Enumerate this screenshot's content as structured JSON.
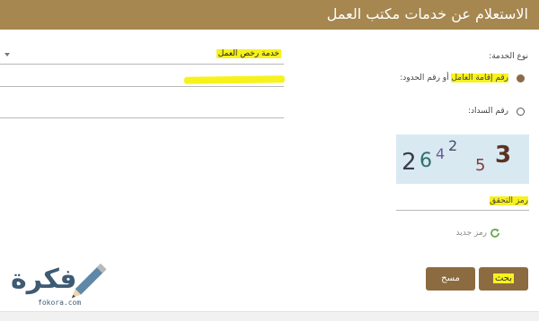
{
  "header": {
    "title": "الاستعلام عن خدمات مكتب العمل"
  },
  "form": {
    "service_type_label": "نوع الخدمة:",
    "service_select_value": "خدمة رخص العمل",
    "radio_iqama": {
      "highlight": "رقم إقامة العامل",
      "rest": " أو رقم الحدود:"
    },
    "radio_sadad": "رقم السداد:",
    "captcha": {
      "digits": [
        "2",
        "6",
        "4",
        "2",
        "5",
        "3"
      ]
    },
    "verify_code_label": "رمز التحقق",
    "new_code_link": "رمز جديد",
    "search_button": "بحث",
    "clear_button": "مسح"
  },
  "logo": {
    "text": "فكرة",
    "caption": "fokora.com"
  },
  "colors": {
    "header": "#a6874f",
    "button": "#8b6b3f",
    "highlight": "#f7f21c",
    "radio_checked": "#8b6b4b",
    "captcha_bg": "#d8e9f2"
  }
}
